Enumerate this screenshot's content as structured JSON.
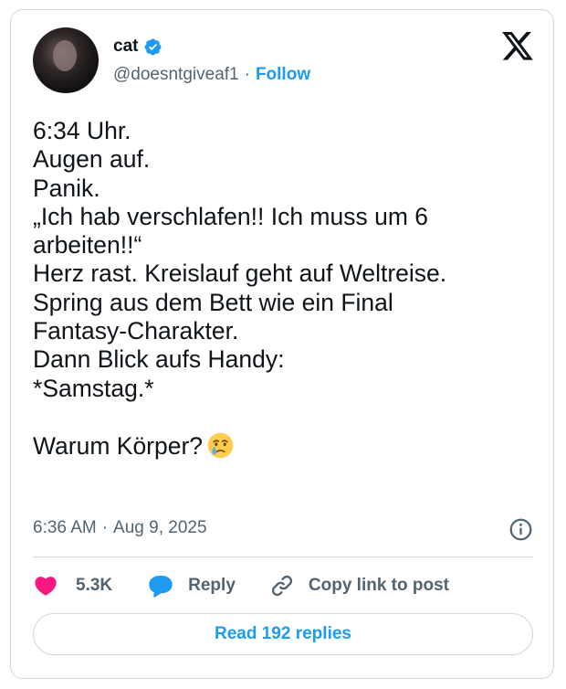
{
  "author": {
    "name": "cat",
    "handle": "@doesntgiveaf1",
    "separator": "·",
    "follow_label": "Follow"
  },
  "tweet": {
    "lines": [
      "6:34 Uhr.",
      "Augen auf.",
      "Panik.",
      "„Ich hab verschlafen!! Ich muss um 6",
      "arbeiten!!“",
      "Herz rast. Kreislauf geht auf Weltreise.",
      "Spring aus dem Bett wie ein Final",
      "Fantasy-Charakter.",
      "Dann Blick aufs Handy:",
      "*Samstag.*",
      "",
      "Warum Körper?"
    ],
    "emoji": "face-holding-back-tears"
  },
  "meta": {
    "time": "6:36 AM",
    "separator": "·",
    "date": "Aug 9, 2025"
  },
  "actions": {
    "likes": "5.3K",
    "reply_label": "Reply",
    "copy_label": "Copy link to post"
  },
  "read_replies_label": "Read 192 replies",
  "icons": {
    "verified": "verified-badge-icon",
    "logo": "x-logo-icon",
    "info": "info-icon",
    "like": "heart-icon",
    "reply": "speech-bubble-icon",
    "copy": "link-icon"
  },
  "colors": {
    "accent": "#1d9bf0",
    "like": "#f91880",
    "text": "#0f1419",
    "secondary": "#536471",
    "border": "#cfd9de"
  }
}
